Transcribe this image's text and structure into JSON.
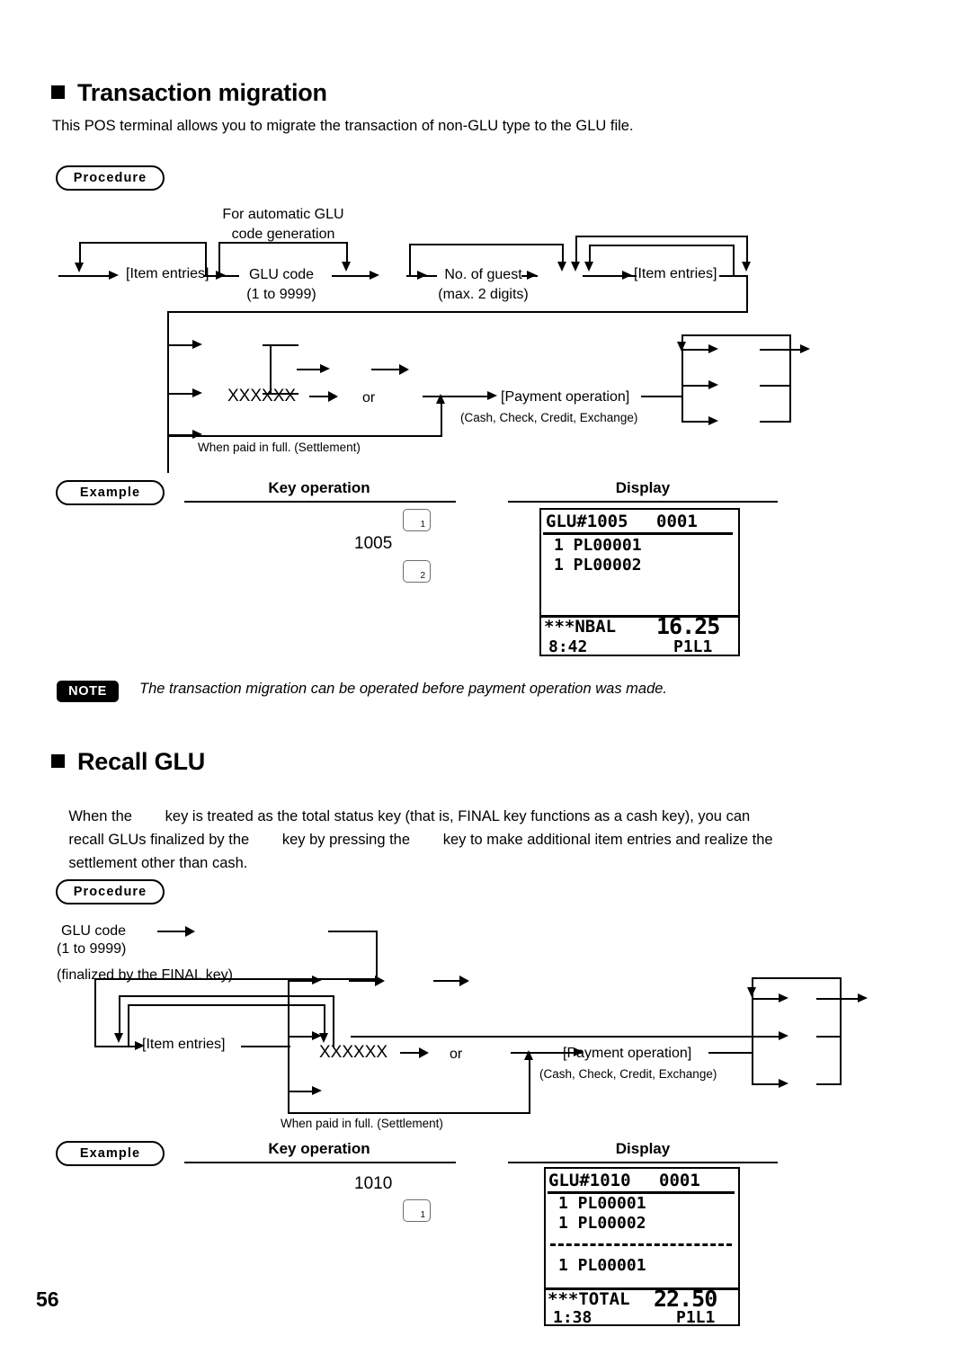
{
  "page": {
    "number": "56"
  },
  "section1": {
    "heading": "Transaction migration",
    "intro": "This POS terminal allows you to migrate the transaction of non-GLU type to the GLU file.",
    "procedure_badge": "Procedure",
    "example_badge": "Example",
    "diagram": {
      "auto_glu_line1": "For automatic GLU",
      "auto_glu_line2": "code generation",
      "item_entries_1": "[Item entries]",
      "glu_code": "GLU code",
      "glu_code_range": "(1 to 9999)",
      "no_of_guest": "No. of guest",
      "no_of_guest_note": "(max. 2 digits)",
      "item_entries_2": "[Item entries]",
      "xxxxxx": "XXXXXX",
      "or": "or",
      "payment_operation": "[Payment operation]",
      "payment_types": "(Cash, Check, Credit, Exchange)",
      "settlement_note": "When paid in full. (Settlement)"
    },
    "columns": {
      "key_operation": "Key operation",
      "display": "Display"
    },
    "key_operation": {
      "code": "1005",
      "key_top_label": "1",
      "key_bottom_label": "2"
    },
    "display": {
      "header_left": "GLU#1005",
      "header_right": "0001",
      "lines": [
        "1 PL00001",
        "1 PL00002"
      ],
      "total_label": "***NBAL",
      "total_value": "16.25",
      "time": "8:42",
      "status": "P1L1"
    }
  },
  "note": {
    "label": "NOTE",
    "text": "The transaction migration can be operated before payment operation was made."
  },
  "section2": {
    "heading": "Recall GLU",
    "body_line1": "When the        key is treated as the total status key (that is, FINAL key functions as a cash key), you can",
    "body_line2": "recall GLUs finalized by the        key by pressing the        key to make additional item entries and realize the",
    "body_line3": "settlement other than cash.",
    "procedure_badge": "Procedure",
    "example_badge": "Example",
    "diagram": {
      "glu_code": "GLU code",
      "glu_code_range": "(1 to 9999)",
      "finalized_note": "(finalized by the FINAL key)",
      "item_entries": "[Item entries]",
      "xxxxxx": "XXXXXX",
      "or": "or",
      "payment_operation": "[Payment operation]",
      "payment_types": "(Cash, Check, Credit, Exchange)",
      "settlement_note": "When paid in full. (Settlement)"
    },
    "columns": {
      "key_operation": "Key operation",
      "display": "Display"
    },
    "key_operation": {
      "code": "1010",
      "key_label": "1"
    },
    "display": {
      "header_left": "GLU#1010",
      "header_right": "0001",
      "lines_top": [
        "1 PL00001",
        "1 PL00002"
      ],
      "lines_bottom": [
        "1 PL00001"
      ],
      "total_label": "***TOTAL",
      "total_value": "22.50",
      "time": "1:38",
      "status": "P1L1"
    }
  }
}
